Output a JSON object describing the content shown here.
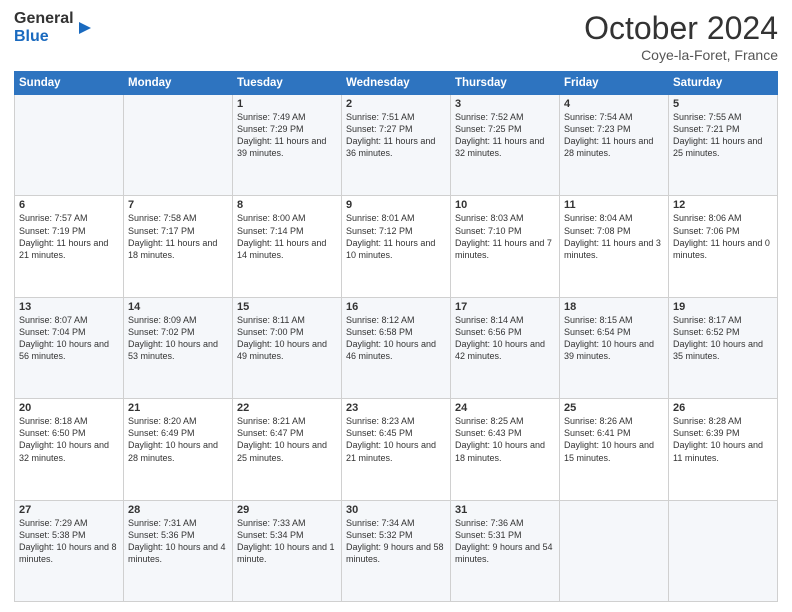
{
  "logo": {
    "general": "General",
    "blue": "Blue"
  },
  "header": {
    "month": "October 2024",
    "location": "Coye-la-Foret, France"
  },
  "days_of_week": [
    "Sunday",
    "Monday",
    "Tuesday",
    "Wednesday",
    "Thursday",
    "Friday",
    "Saturday"
  ],
  "weeks": [
    [
      {
        "day": "",
        "info": ""
      },
      {
        "day": "",
        "info": ""
      },
      {
        "day": "1",
        "info": "Sunrise: 7:49 AM\nSunset: 7:29 PM\nDaylight: 11 hours and 39 minutes."
      },
      {
        "day": "2",
        "info": "Sunrise: 7:51 AM\nSunset: 7:27 PM\nDaylight: 11 hours and 36 minutes."
      },
      {
        "day": "3",
        "info": "Sunrise: 7:52 AM\nSunset: 7:25 PM\nDaylight: 11 hours and 32 minutes."
      },
      {
        "day": "4",
        "info": "Sunrise: 7:54 AM\nSunset: 7:23 PM\nDaylight: 11 hours and 28 minutes."
      },
      {
        "day": "5",
        "info": "Sunrise: 7:55 AM\nSunset: 7:21 PM\nDaylight: 11 hours and 25 minutes."
      }
    ],
    [
      {
        "day": "6",
        "info": "Sunrise: 7:57 AM\nSunset: 7:19 PM\nDaylight: 11 hours and 21 minutes."
      },
      {
        "day": "7",
        "info": "Sunrise: 7:58 AM\nSunset: 7:17 PM\nDaylight: 11 hours and 18 minutes."
      },
      {
        "day": "8",
        "info": "Sunrise: 8:00 AM\nSunset: 7:14 PM\nDaylight: 11 hours and 14 minutes."
      },
      {
        "day": "9",
        "info": "Sunrise: 8:01 AM\nSunset: 7:12 PM\nDaylight: 11 hours and 10 minutes."
      },
      {
        "day": "10",
        "info": "Sunrise: 8:03 AM\nSunset: 7:10 PM\nDaylight: 11 hours and 7 minutes."
      },
      {
        "day": "11",
        "info": "Sunrise: 8:04 AM\nSunset: 7:08 PM\nDaylight: 11 hours and 3 minutes."
      },
      {
        "day": "12",
        "info": "Sunrise: 8:06 AM\nSunset: 7:06 PM\nDaylight: 11 hours and 0 minutes."
      }
    ],
    [
      {
        "day": "13",
        "info": "Sunrise: 8:07 AM\nSunset: 7:04 PM\nDaylight: 10 hours and 56 minutes."
      },
      {
        "day": "14",
        "info": "Sunrise: 8:09 AM\nSunset: 7:02 PM\nDaylight: 10 hours and 53 minutes."
      },
      {
        "day": "15",
        "info": "Sunrise: 8:11 AM\nSunset: 7:00 PM\nDaylight: 10 hours and 49 minutes."
      },
      {
        "day": "16",
        "info": "Sunrise: 8:12 AM\nSunset: 6:58 PM\nDaylight: 10 hours and 46 minutes."
      },
      {
        "day": "17",
        "info": "Sunrise: 8:14 AM\nSunset: 6:56 PM\nDaylight: 10 hours and 42 minutes."
      },
      {
        "day": "18",
        "info": "Sunrise: 8:15 AM\nSunset: 6:54 PM\nDaylight: 10 hours and 39 minutes."
      },
      {
        "day": "19",
        "info": "Sunrise: 8:17 AM\nSunset: 6:52 PM\nDaylight: 10 hours and 35 minutes."
      }
    ],
    [
      {
        "day": "20",
        "info": "Sunrise: 8:18 AM\nSunset: 6:50 PM\nDaylight: 10 hours and 32 minutes."
      },
      {
        "day": "21",
        "info": "Sunrise: 8:20 AM\nSunset: 6:49 PM\nDaylight: 10 hours and 28 minutes."
      },
      {
        "day": "22",
        "info": "Sunrise: 8:21 AM\nSunset: 6:47 PM\nDaylight: 10 hours and 25 minutes."
      },
      {
        "day": "23",
        "info": "Sunrise: 8:23 AM\nSunset: 6:45 PM\nDaylight: 10 hours and 21 minutes."
      },
      {
        "day": "24",
        "info": "Sunrise: 8:25 AM\nSunset: 6:43 PM\nDaylight: 10 hours and 18 minutes."
      },
      {
        "day": "25",
        "info": "Sunrise: 8:26 AM\nSunset: 6:41 PM\nDaylight: 10 hours and 15 minutes."
      },
      {
        "day": "26",
        "info": "Sunrise: 8:28 AM\nSunset: 6:39 PM\nDaylight: 10 hours and 11 minutes."
      }
    ],
    [
      {
        "day": "27",
        "info": "Sunrise: 7:29 AM\nSunset: 5:38 PM\nDaylight: 10 hours and 8 minutes."
      },
      {
        "day": "28",
        "info": "Sunrise: 7:31 AM\nSunset: 5:36 PM\nDaylight: 10 hours and 4 minutes."
      },
      {
        "day": "29",
        "info": "Sunrise: 7:33 AM\nSunset: 5:34 PM\nDaylight: 10 hours and 1 minute."
      },
      {
        "day": "30",
        "info": "Sunrise: 7:34 AM\nSunset: 5:32 PM\nDaylight: 9 hours and 58 minutes."
      },
      {
        "day": "31",
        "info": "Sunrise: 7:36 AM\nSunset: 5:31 PM\nDaylight: 9 hours and 54 minutes."
      },
      {
        "day": "",
        "info": ""
      },
      {
        "day": "",
        "info": ""
      }
    ]
  ]
}
